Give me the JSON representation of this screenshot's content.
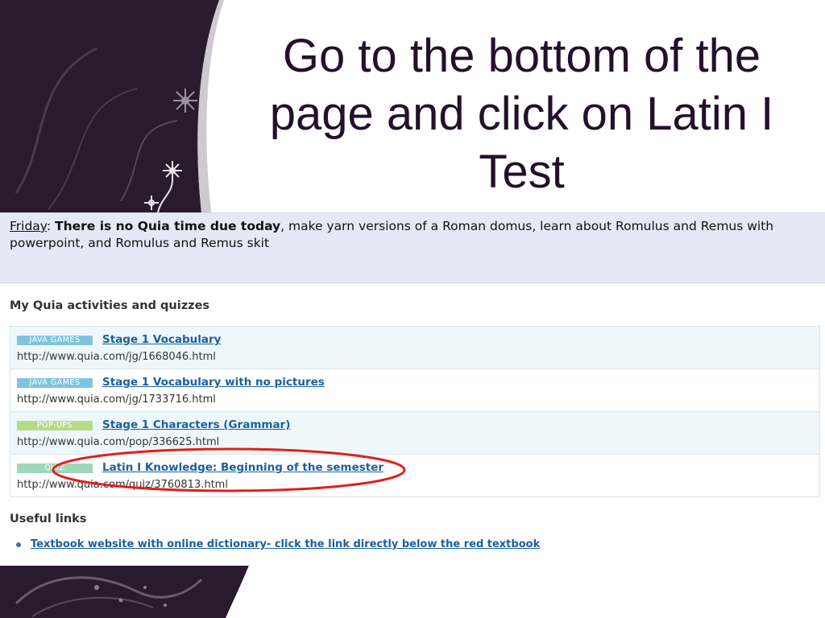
{
  "slide": {
    "title_lines": [
      "Go to the bottom of the",
      "page and click on Latin I",
      "Test"
    ]
  },
  "banner": {
    "day": "Friday",
    "colon": ":",
    "bold_text": "There is no Quia time due today",
    "rest_text": ", make yarn versions of a Roman domus, learn about Romulus and Remus with powerpoint, and Romulus and Remus skit"
  },
  "activities": {
    "heading": "My Quia activities and quizzes",
    "items": [
      {
        "tag": "JAVA GAMES",
        "title": "Stage 1 Vocabulary",
        "url": "http://www.quia.com/jg/1668046.html"
      },
      {
        "tag": "JAVA GAMES",
        "title": "Stage 1 Vocabulary with no pictures",
        "url": "http://www.quia.com/jg/1733716.html"
      },
      {
        "tag": "POP-UPS",
        "title": "Stage 1 Characters (Grammar)",
        "url": "http://www.quia.com/pop/336625.html"
      },
      {
        "tag": "QUIZ",
        "title": "Latin I Knowledge: Beginning of the semester",
        "url": "http://www.quia.com/quiz/3760813.html"
      }
    ]
  },
  "useful": {
    "heading": "Useful links",
    "items": [
      {
        "label": "Textbook website with online dictionary- click the link directly below the red textbook"
      }
    ]
  },
  "colors": {
    "deco_dark": "#2a1a2e",
    "title": "#24102a",
    "link": "#1a5f9e",
    "highlight": "#e0201c",
    "banner_bg": "#e6e8f5"
  }
}
